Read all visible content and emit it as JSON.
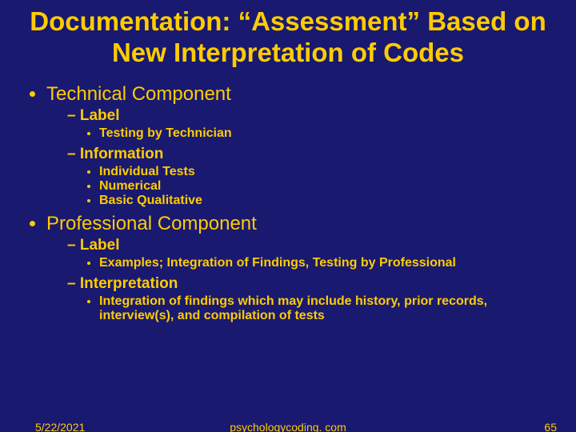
{
  "title": "Documentation: “Assessment” Based on New Interpretation of Codes",
  "bullets": {
    "tech": {
      "heading": "Technical Component",
      "label": {
        "heading": "Label",
        "items": [
          "Testing by Technician"
        ]
      },
      "info": {
        "heading": "Information",
        "items": [
          "Individual Tests",
          "Numerical",
          "Basic Qualitative"
        ]
      }
    },
    "prof": {
      "heading": "Professional Component",
      "label": {
        "heading": "Label",
        "items": [
          "Examples; Integration of Findings, Testing by Professional"
        ]
      },
      "interp": {
        "heading": "Interpretation",
        "items": [
          "Integration of findings which may include history, prior records, interview(s), and compilation of tests"
        ]
      }
    }
  },
  "footer": {
    "date": "5/22/2021",
    "center": "psychologycoding. com",
    "page": "65"
  }
}
